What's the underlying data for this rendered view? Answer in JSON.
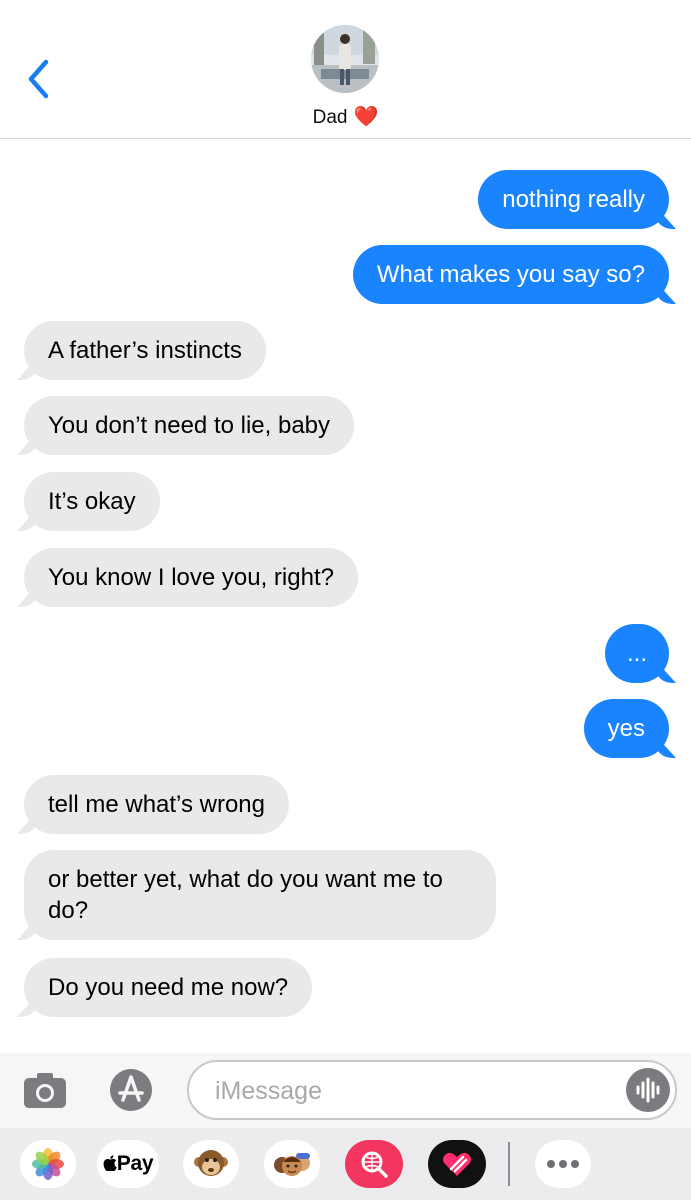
{
  "contact": {
    "name": "Dad",
    "emoji": "❤️"
  },
  "messages": [
    {
      "dir": "out",
      "text": "nothing really"
    },
    {
      "dir": "out",
      "text": "What makes you say so?"
    },
    {
      "dir": "in",
      "text": "A father’s instincts"
    },
    {
      "dir": "in",
      "text": "You don’t need to lie, baby"
    },
    {
      "dir": "in",
      "text": "It’s okay"
    },
    {
      "dir": "in",
      "text": "You know I love you, right?"
    },
    {
      "dir": "out",
      "text": "..."
    },
    {
      "dir": "out",
      "text": "yes"
    },
    {
      "dir": "in",
      "text": "tell me what’s wrong"
    },
    {
      "dir": "in",
      "text": "or better yet, what do you want me to do?"
    },
    {
      "dir": "in",
      "text": "Do you need me now?"
    }
  ],
  "input": {
    "placeholder": "iMessage",
    "value": ""
  },
  "drawer": {
    "applepay_label": "Pay"
  },
  "colors": {
    "outgoing": "#1a84ff",
    "incoming": "#e9e9eb",
    "accent": "#1a7cf5"
  },
  "icons": [
    "back-chevron-icon",
    "camera-icon",
    "app-store-icon",
    "audio-record-icon",
    "photos-app-icon",
    "apple-pay-app-icon",
    "monkey-animoji-icon",
    "memoji-stickers-icon",
    "web-search-icon",
    "digital-touch-icon",
    "more-apps-icon"
  ]
}
